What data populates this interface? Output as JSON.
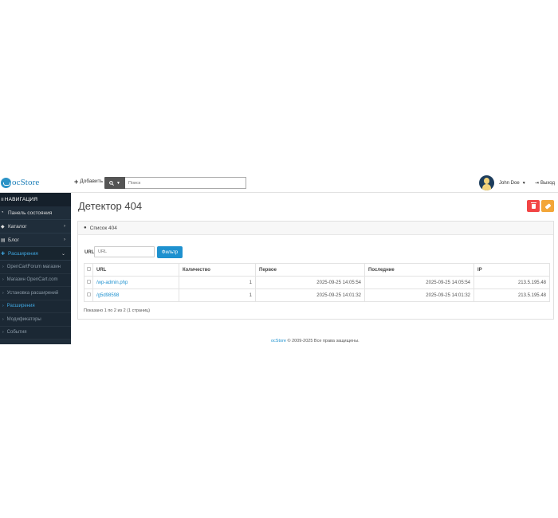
{
  "header": {
    "logo_text": "oc Store",
    "logo_prefix": "oc",
    "logo_suffix": "Store",
    "add_label": "Добавить",
    "search_placeholder": "Поиск",
    "user_name": "John Doe",
    "logout_label": "Выход"
  },
  "sidebar": {
    "title": "НАВИГАЦИЯ",
    "items": [
      {
        "label": "Панель состояния",
        "icon": "dashboard-icon",
        "chevron": ""
      },
      {
        "label": "Каталог",
        "icon": "tags-icon",
        "chevron": "›"
      },
      {
        "label": "Блог",
        "icon": "book-icon",
        "chevron": "›"
      },
      {
        "label": "Расширения",
        "icon": "puzzle-icon",
        "chevron": "⌄"
      }
    ],
    "subitems": [
      {
        "label": "OpenCartForum магазин"
      },
      {
        "label": "Магазин OpenCart.com"
      },
      {
        "label": "Установка расширений"
      },
      {
        "label": "Расширения"
      },
      {
        "label": "Модификаторы"
      },
      {
        "label": "События"
      }
    ]
  },
  "main": {
    "title": "Детектор 404",
    "panel_title": "Список 404",
    "filter": {
      "label": "URL",
      "placeholder": "URL",
      "button": "Фильтр"
    },
    "table": {
      "columns": [
        "URL",
        "Количество",
        "Первое",
        "Последние",
        "IP"
      ],
      "rows": [
        {
          "url": "/wp-admin.php",
          "count": "1",
          "first": "2025-09-25 14:05:54",
          "last": "2025-09-25 14:05:54",
          "ip": "213.5.195.48"
        },
        {
          "url": "/g5d98598",
          "count": "1",
          "first": "2025-09-25 14:01:32",
          "last": "2025-09-25 14:01:32",
          "ip": "213.5.195.48"
        }
      ]
    },
    "pagination_text": "Показано 1 по 2 из 2 (1 страниц)"
  },
  "footer": {
    "brand": "ocStore",
    "text": " © 2009-2025 Все права защищены."
  },
  "colors": {
    "sidebar_bg": "#1f2d3a",
    "accent": "#1e91cf",
    "delete": "#f24545",
    "clear": "#f3a638"
  }
}
